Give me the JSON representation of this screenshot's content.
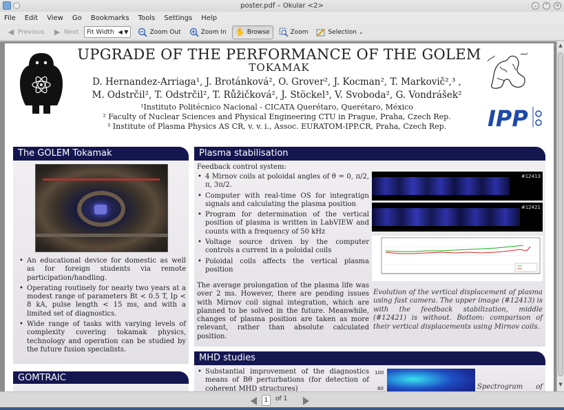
{
  "window": {
    "title": "poster.pdf – Okular <2>"
  },
  "menu": [
    "File",
    "Edit",
    "View",
    "Go",
    "Bookmarks",
    "Tools",
    "Settings",
    "Help"
  ],
  "toolbar": {
    "previous": "Previous",
    "next": "Next",
    "zoom_mode": "Fit Width",
    "zoom_out": "Zoom Out",
    "zoom_in": "Zoom In",
    "browse": "Browse",
    "zoom": "Zoom",
    "selection": "Selection"
  },
  "poster": {
    "title_line1": "UPGRADE OF THE PERFORMANCE OF THE GOLEM",
    "title_line2": "TOKAMAK",
    "authors_line1": "D. Hernandez-Arriaga¹, J. Brotánková², O. Grover², J. Kocman², T. Markovič²,³ ,",
    "authors_line2": "M. Odstrčil², T. Odstrčil², T. Růžičková², J. Stöckel³, V. Svoboda², G. Vondrášek²",
    "aff1": "¹Instituto Politécnico Nacional - CICATA Querétaro, Querétaro, México",
    "aff2": "² Faculty of Nuclear Sciences and Physical Engineering CTU in Prague, Praha, Czech Rep.",
    "aff3": "³ Institute of Plasma Physics AS CR, v. v. i., Assoc. EURATOM-IPP.CR, Praha, Czech Rep.",
    "ipp_logo": "IPP",
    "golem": {
      "heading": "The GOLEM Tokamak",
      "bullets": [
        "An educational device for domestic as well as for foreign students via remote participation/handling.",
        "Operating routinely for nearly two years at a modest range of parameters Bt < 0.5 T, Ip < 8 kA, pulse length < 15 ms, and with a limited set of diagnostics.",
        "Wide range of tasks with varying levels of complexity covering tokamak physics, technology and operation can be studied by the future fusion specialists."
      ]
    },
    "gomtraic": {
      "heading": "GOMTRAIC"
    },
    "plasma": {
      "heading": "Plasma stabilisation",
      "intro": "Feedback control system:",
      "bullets": [
        "4 Mirnov coils at poloidal angles of θ = 0, π/2, π, 3π/2.",
        "Computer with real-time OS for integratign signals and calculating the plasma position",
        "Program for determination of the vertical position of plasma is written in LabVIEW and counts with a frequency of 50 kHz",
        "Voltage source driven by the computer controls a current in a poloidal coils",
        "Poloidal coils affects the vertical plasma position"
      ],
      "paragraph": "The average prolongation of the plasma life was over 2 ms. However, there are pending issues with Mirnov coil signal integration, which are planned to be solved in the future. Meanwhile, changes of plasma position are taken as more relevant, rather than absolute calculated position.",
      "caption": "Evolution of the vertical displacement of plasma using fast camera. The upper image (#12413) is with the feedback stabilization, middle (#12421) is without. Bottom: comparison of their vertical displacements using Mirnov coils.",
      "shot1": "#12413",
      "shot2": "#12421"
    },
    "mhd": {
      "heading": "MHD studies",
      "bullet": "Substantial improvement of the diagnostics means of Bθ perturbations (for detection of coherent MHD structures)",
      "axis_top": "100",
      "axis_mid": "80",
      "spectrogram_caption": "Spectrogram of"
    }
  },
  "pager": {
    "current": "1",
    "of_text": "of 1"
  }
}
